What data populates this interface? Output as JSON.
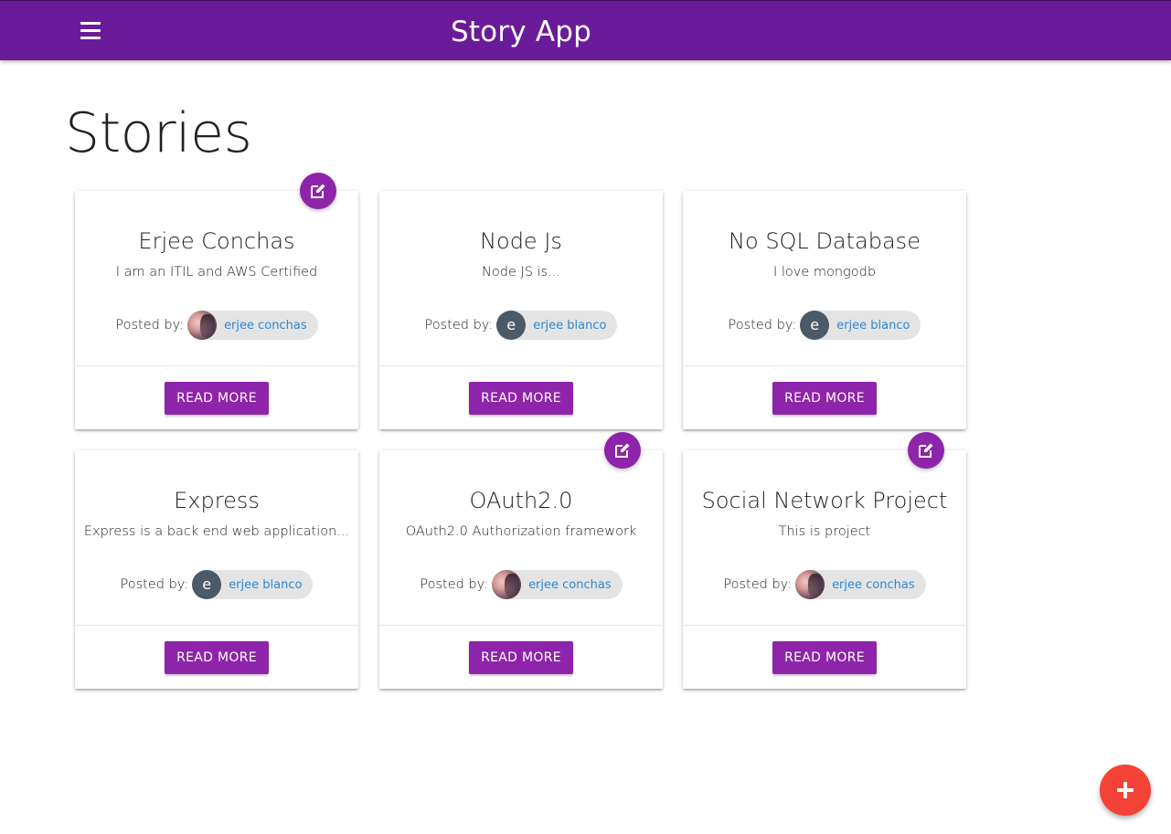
{
  "app": {
    "title": "Story App"
  },
  "page": {
    "title": "Stories"
  },
  "colors": {
    "navbar": "#6a1b9a",
    "accent": "#8e24aa",
    "fab": "#f44336",
    "link": "#2f87d0"
  },
  "icons": {
    "menu": "menu-icon",
    "edit": "edit-icon",
    "add": "plus-icon"
  },
  "stories": [
    {
      "title": "Erjee Conchas",
      "body": "I am an ITIL and AWS Certified",
      "posted_label": "Posted by:",
      "author": "erjee conchas",
      "avatar": "photo",
      "editable": true,
      "button": "READ MORE"
    },
    {
      "title": "Node Js",
      "body": "Node JS is...",
      "posted_label": "Posted by:",
      "author": "erjee blanco",
      "avatar": "e",
      "editable": false,
      "button": "READ MORE"
    },
    {
      "title": "No SQL Database",
      "body": "I love mongodb",
      "posted_label": "Posted by:",
      "author": "erjee blanco",
      "avatar": "e",
      "editable": false,
      "button": "READ MORE"
    },
    {
      "title": "Express",
      "body": "Express is a back end web application...",
      "posted_label": "Posted by:",
      "author": "erjee blanco",
      "avatar": "e",
      "editable": false,
      "button": "READ MORE"
    },
    {
      "title": "OAuth2.0",
      "body": "OAuth2.0 Authorization framework",
      "posted_label": "Posted by:",
      "author": "erjee conchas",
      "avatar": "photo",
      "editable": true,
      "button": "READ MORE"
    },
    {
      "title": "Social Network Project",
      "body": "This is project",
      "posted_label": "Posted by:",
      "author": "erjee conchas",
      "avatar": "photo",
      "editable": true,
      "button": "READ MORE"
    }
  ]
}
